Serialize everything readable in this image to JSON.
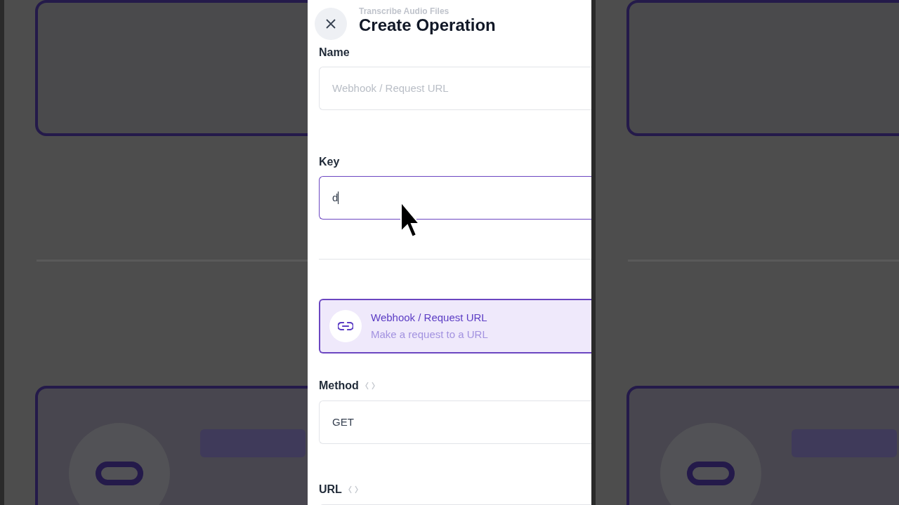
{
  "dialog": {
    "subtitle": "Transcribe Audio Files",
    "title": "Create Operation"
  },
  "fields": [
    {
      "label": "Name",
      "placeholder": "Webhook / Request URL",
      "focused": false
    },
    {
      "label": "Key",
      "value": "d",
      "focused": true
    }
  ],
  "operation_type": {
    "title": "Webhook / Request URL",
    "description": "Make a request to a URL",
    "selected": true
  },
  "settings": [
    {
      "label": "Method",
      "value": "GET"
    },
    {
      "label": "URL"
    }
  ]
}
